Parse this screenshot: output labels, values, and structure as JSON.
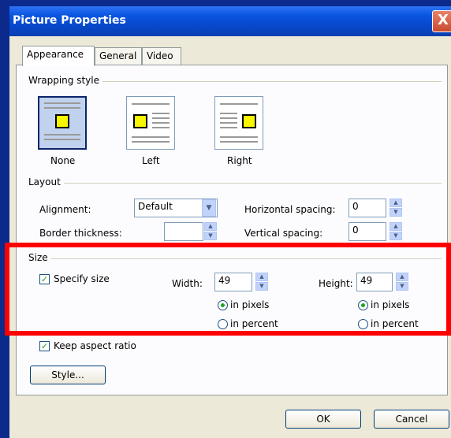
{
  "window": {
    "title": "Picture Properties",
    "close_glyph": "X"
  },
  "tabs": [
    {
      "label": "Appearance",
      "active": true
    },
    {
      "label": "General",
      "active": false
    },
    {
      "label": "Video",
      "active": false
    }
  ],
  "wrapping": {
    "group_label": "Wrapping style",
    "options": [
      {
        "label": "None",
        "selected": true
      },
      {
        "label": "Left",
        "selected": false
      },
      {
        "label": "Right",
        "selected": false
      }
    ]
  },
  "layout": {
    "group_label": "Layout",
    "alignment_label": "Alignment:",
    "alignment_value": "Default",
    "border_label": "Border thickness:",
    "border_value": "",
    "hspacing_label": "Horizontal spacing:",
    "hspacing_value": "0",
    "vspacing_label": "Vertical spacing:",
    "vspacing_value": "0"
  },
  "size": {
    "group_label": "Size",
    "specify_label": "Specify size",
    "width_label": "Width:",
    "width_value": "49",
    "height_label": "Height:",
    "height_value": "49",
    "pixels_label": "in pixels",
    "percent_label": "in percent",
    "keep_aspect_label": "Keep aspect ratio"
  },
  "buttons": {
    "style": "Style...",
    "ok": "OK",
    "cancel": "Cancel"
  },
  "colors": {
    "titlebar": "#0746c8",
    "highlight": "#ff0000",
    "check": "#21a121"
  }
}
